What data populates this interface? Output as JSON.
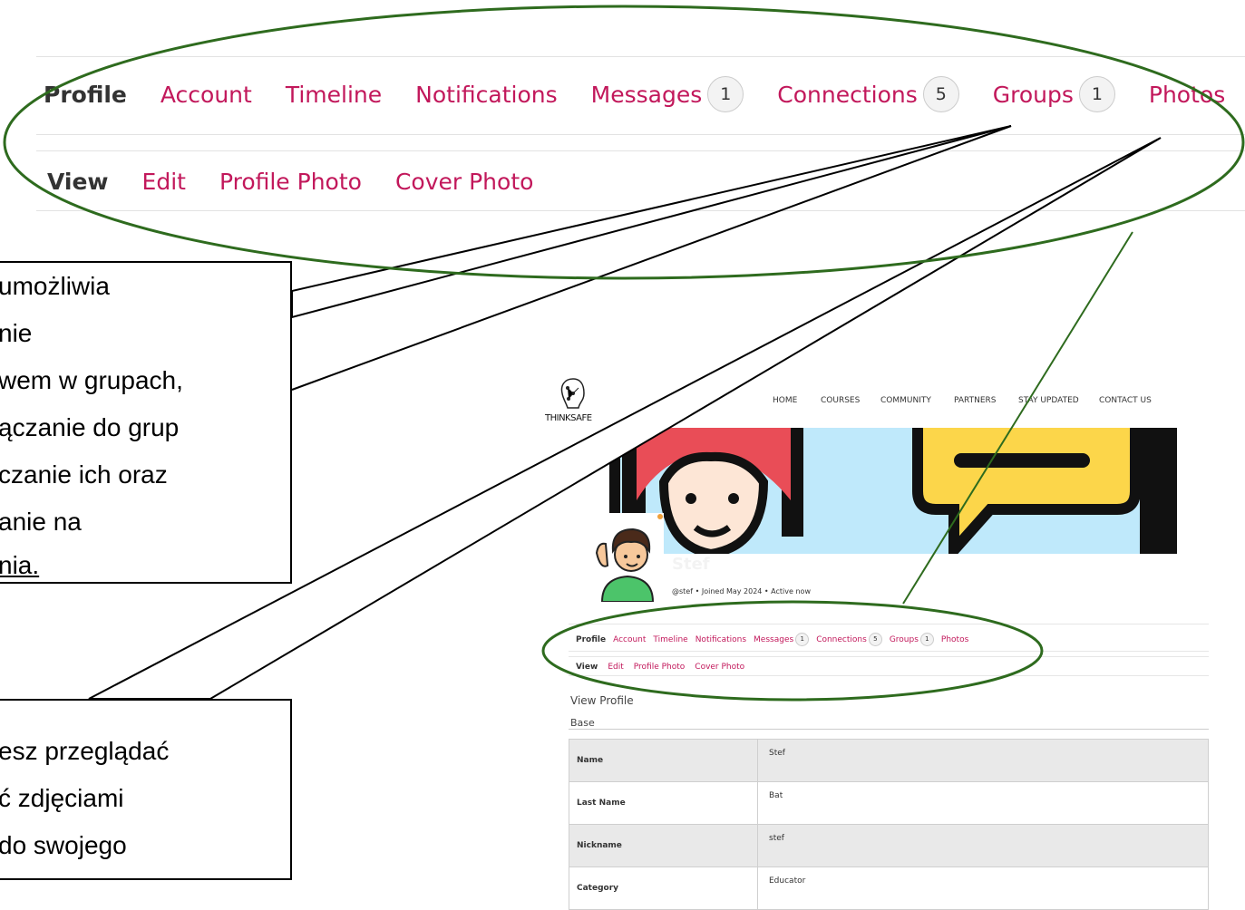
{
  "zoomed_nav": {
    "tabs": [
      {
        "label": "Profile",
        "active": true
      },
      {
        "label": "Account"
      },
      {
        "label": "Timeline"
      },
      {
        "label": "Notifications"
      },
      {
        "label": "Messages",
        "badge": "1"
      },
      {
        "label": "Connections",
        "badge": "5"
      },
      {
        "label": "Groups",
        "badge": "1"
      },
      {
        "label": "Photos"
      }
    ],
    "subtabs": [
      {
        "label": "View",
        "active": true
      },
      {
        "label": "Edit"
      },
      {
        "label": "Profile Photo"
      },
      {
        "label": "Cover Photo"
      }
    ]
  },
  "callout_groups": {
    "lines": [
      "umożliwia",
      "nie",
      "wem w grupach,",
      "ączanie do grup",
      "czanie ich oraz",
      "anie na",
      "nia."
    ]
  },
  "callout_photos": {
    "lines": [
      "esz przeglądać",
      "ć zdjęciami",
      " do swojego"
    ]
  },
  "site": {
    "logo_text": "THINKSAFE",
    "nav": [
      "HOME",
      "COURSES",
      "COMMUNITY",
      "PARTNERS",
      "STAY UPDATED",
      "CONTACT US"
    ],
    "profile_name": "Stef",
    "meta": "@stef • Joined May 2024 • Active now",
    "tabs": [
      {
        "label": "Profile",
        "active": true
      },
      {
        "label": "Account"
      },
      {
        "label": "Timeline"
      },
      {
        "label": "Notifications"
      },
      {
        "label": "Messages",
        "badge": "1"
      },
      {
        "label": "Connections",
        "badge": "5"
      },
      {
        "label": "Groups",
        "badge": "1"
      },
      {
        "label": "Photos"
      }
    ],
    "subtabs": [
      {
        "label": "View",
        "active": true
      },
      {
        "label": "Edit"
      },
      {
        "label": "Profile Photo"
      },
      {
        "label": "Cover Photo"
      }
    ],
    "view_profile": "View Profile",
    "base": "Base",
    "fields": [
      {
        "key": "Name",
        "value": "Stef"
      },
      {
        "key": "Last Name",
        "value": "Bat"
      },
      {
        "key": "Nickname",
        "value": "stef"
      },
      {
        "key": "Category",
        "value": "Educator"
      }
    ]
  },
  "colors": {
    "accent": "#c2185b",
    "annotation": "#2e6b1e"
  }
}
